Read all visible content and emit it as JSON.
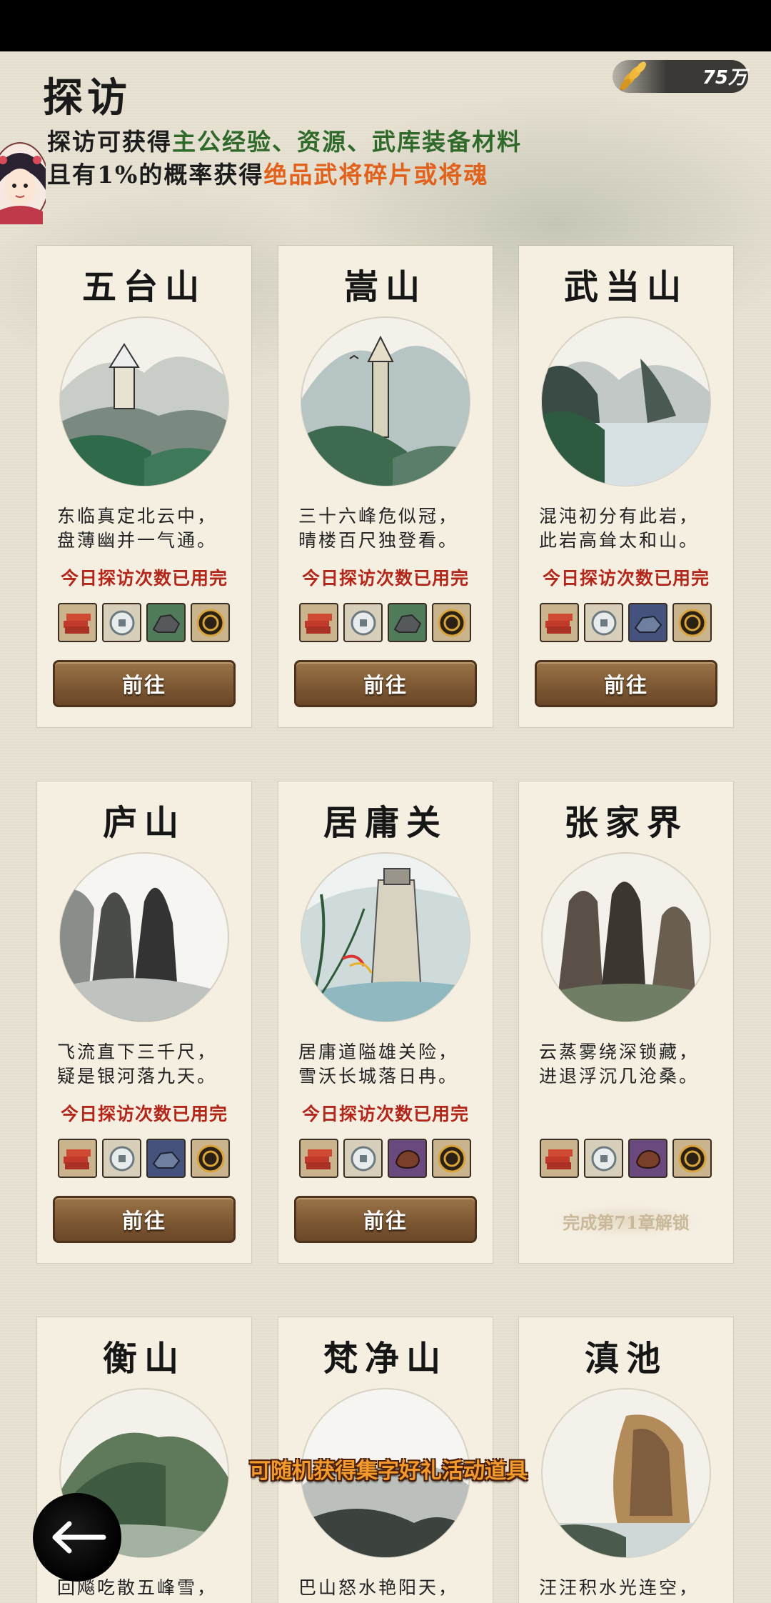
{
  "header": {
    "title": "探访",
    "currency_value": "75万",
    "intro_line1": {
      "prefix": "探访可获得",
      "highlight": "主公经验、资源、武库装备材料"
    },
    "intro_line2": {
      "prefix": "且有1%的概率获得",
      "highlight": "绝品武将碎片或将魂"
    }
  },
  "colors": {
    "intro_green": "#2f6a2a",
    "intro_orange": "#e0621c",
    "status_red": "#b3271b",
    "button_brown": "#7b5632",
    "banner_orange": "#f39a2c"
  },
  "cards": [
    {
      "title": "五台山",
      "poem1": "东临真定北云中，",
      "poem2": "盘薄幽并一气通。",
      "status": "今日探访次数已用完",
      "button": "前往",
      "rewards": [
        "wood-icon",
        "coin-icon",
        "ore-icon",
        "token-icon"
      ]
    },
    {
      "title": "嵩山",
      "poem1": "三十六峰危似冠，",
      "poem2": "晴楼百尺独登看。",
      "status": "今日探访次数已用完",
      "button": "前往",
      "rewards": [
        "wood-icon",
        "coin-icon",
        "ore-icon",
        "token-icon"
      ]
    },
    {
      "title": "武当山",
      "poem1": "混沌初分有此岩，",
      "poem2": "此岩高耸太和山。",
      "status": "今日探访次数已用完",
      "button": "前往",
      "rewards": [
        "wood-icon",
        "coin-icon",
        "iron-icon",
        "token-icon"
      ]
    },
    {
      "title": "庐山",
      "poem1": "飞流直下三千尺，",
      "poem2": "疑是银河落九天。",
      "status": "今日探访次数已用完",
      "button": "前往",
      "rewards": [
        "wood-icon",
        "coin-icon",
        "iron-icon",
        "token-icon"
      ]
    },
    {
      "title": "居庸关",
      "poem1": "居庸道隘雄关险，",
      "poem2": "雪沃长城落日冉。",
      "status": "今日探访次数已用完",
      "button": "前往",
      "rewards": [
        "wood-icon",
        "coin-icon",
        "leather-icon",
        "token-icon"
      ]
    },
    {
      "title": "张家界",
      "poem1": "云蒸雾绕深锁藏，",
      "poem2": "进退浮沉几沧桑。",
      "status": "",
      "lock_text": "完成第71章解锁",
      "rewards": [
        "wood-icon",
        "coin-icon",
        "leather-icon",
        "token-icon"
      ]
    },
    {
      "title": "衡山",
      "poem1": "回飚吃散五峰雪，"
    },
    {
      "title": "梵净山",
      "poem1": "巴山怒水艳阳天，"
    },
    {
      "title": "滇池",
      "poem1": "汪汪积水光连空，"
    }
  ],
  "banner": "可随机获得集字好礼活动道具"
}
